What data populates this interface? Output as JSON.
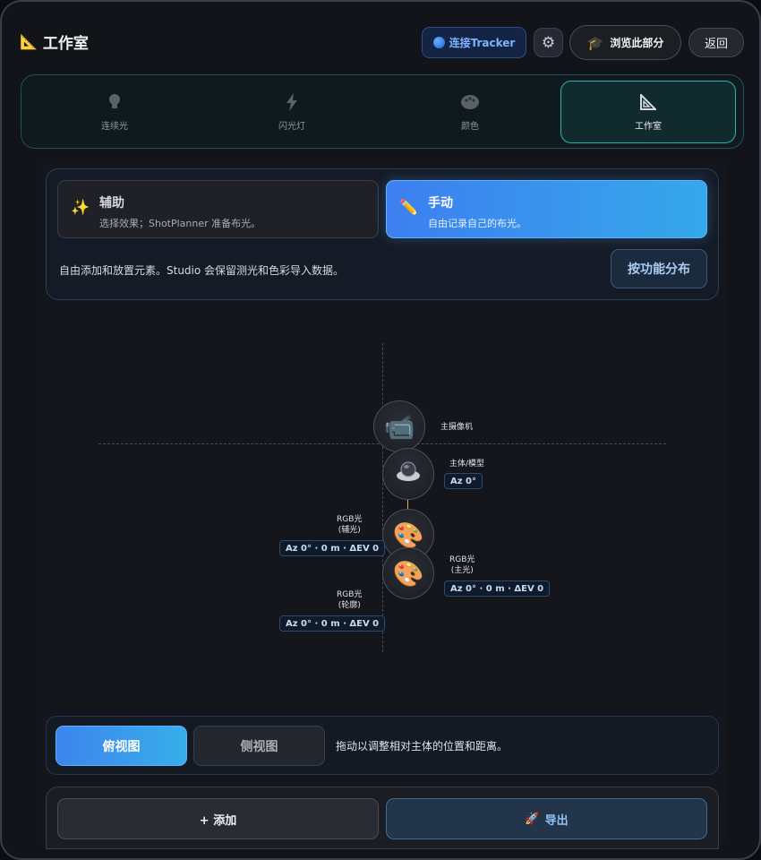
{
  "header": {
    "title": "工作室",
    "title_icon": "triangle-ruler-icon",
    "tracker_label": "连接Tracker",
    "browse_label": "浏览此部分",
    "back_label": "返回"
  },
  "tabs": [
    {
      "label": "连续光",
      "icon": "bulb-icon",
      "active": false
    },
    {
      "label": "闪光灯",
      "icon": "lightning-icon",
      "active": false
    },
    {
      "label": "颜色",
      "icon": "palette-icon",
      "active": false
    },
    {
      "label": "工作室",
      "icon": "triangle-ruler-icon",
      "active": true
    }
  ],
  "mode": {
    "assist": {
      "title": "辅助",
      "desc": "选择效果；ShotPlanner 准备布光。",
      "icon": "sparkles-icon"
    },
    "manual": {
      "title": "手动",
      "desc": "自由记录自己的布光。",
      "icon": "pencil-icon",
      "selected": true
    },
    "description": "自由添加和放置元素。Studio 会保留测光和色彩导入数据。",
    "function_button": "按功能分布"
  },
  "canvas": {
    "camera": {
      "label": "主摄像机"
    },
    "subject": {
      "label": "主体/模型",
      "chip": "Az 0°"
    },
    "fill": {
      "label_line1": "RGB光",
      "label_line2": "(辅光)",
      "chip": "Az 0° · 0 m · ΔEV 0"
    },
    "key": {
      "label_line1": "RGB光",
      "label_line2": "(主光)",
      "chip": "Az 0° · 0 m · ΔEV 0"
    },
    "rim": {
      "label_line1": "RGB光",
      "label_line2": "(轮廓)",
      "chip": "Az 0° · 0 m · ΔEV 0"
    }
  },
  "view": {
    "top_label": "俯视图",
    "side_label": "侧视图",
    "hint": "拖动以调整相对主体的位置和距离。",
    "active": "top"
  },
  "actions": {
    "add_label": "+ 添加",
    "export_label": "导出",
    "export_icon": "rocket-icon"
  },
  "colors": {
    "accent_blue": "#3d85ee",
    "active_tab_border": "#2fb3b0",
    "background": "#12141a"
  }
}
